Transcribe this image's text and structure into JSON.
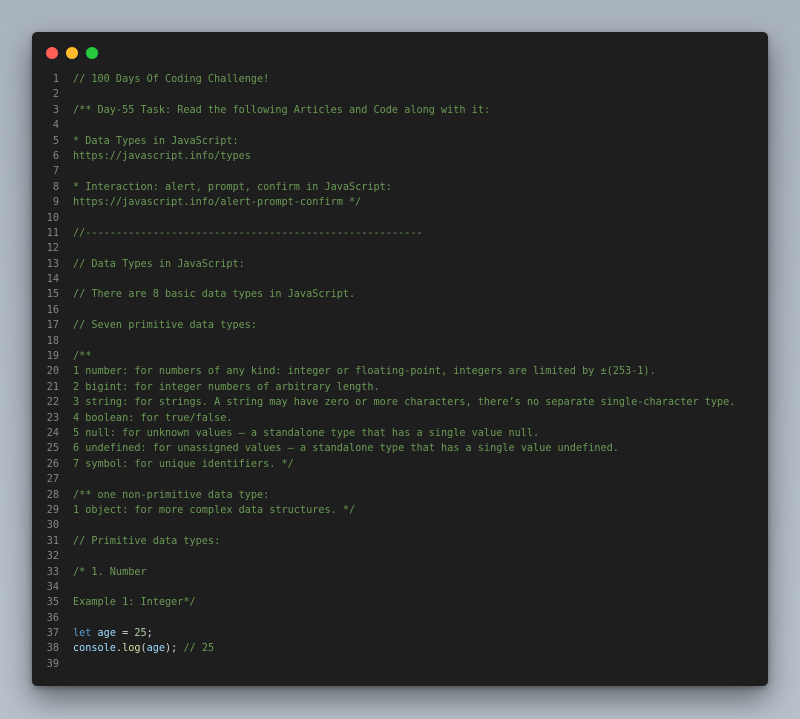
{
  "window": {
    "controls": [
      {
        "name": "close",
        "color": "#ff5f56"
      },
      {
        "name": "minimize",
        "color": "#ffbd2e"
      },
      {
        "name": "maximize",
        "color": "#27c93f"
      }
    ]
  },
  "lines": [
    {
      "n": "1",
      "tokens": [
        {
          "t": "comment",
          "v": "// 100 Days Of Coding Challenge!"
        }
      ]
    },
    {
      "n": "2",
      "tokens": []
    },
    {
      "n": "3",
      "tokens": [
        {
          "t": "comment",
          "v": "/** Day-55 Task: Read the following Articles and Code along with it:"
        }
      ]
    },
    {
      "n": "4",
      "tokens": []
    },
    {
      "n": "5",
      "tokens": [
        {
          "t": "comment",
          "v": "* Data Types in JavaScript:"
        }
      ]
    },
    {
      "n": "6",
      "tokens": [
        {
          "t": "comment",
          "v": "https://javascript.info/types"
        }
      ]
    },
    {
      "n": "7",
      "tokens": []
    },
    {
      "n": "8",
      "tokens": [
        {
          "t": "comment",
          "v": "* Interaction: alert, prompt, confirm in JavaScript:"
        }
      ]
    },
    {
      "n": "9",
      "tokens": [
        {
          "t": "comment",
          "v": "https://javascript.info/alert-prompt-confirm */"
        }
      ]
    },
    {
      "n": "10",
      "tokens": []
    },
    {
      "n": "11",
      "tokens": [
        {
          "t": "comment",
          "v": "//-------------------------------------------------------"
        }
      ]
    },
    {
      "n": "12",
      "tokens": []
    },
    {
      "n": "13",
      "tokens": [
        {
          "t": "comment",
          "v": "// Data Types in JavaScript:"
        }
      ]
    },
    {
      "n": "14",
      "tokens": []
    },
    {
      "n": "15",
      "tokens": [
        {
          "t": "comment",
          "v": "// There are 8 basic data types in JavaScript."
        }
      ]
    },
    {
      "n": "16",
      "tokens": []
    },
    {
      "n": "17",
      "tokens": [
        {
          "t": "comment",
          "v": "// Seven primitive data types:"
        }
      ]
    },
    {
      "n": "18",
      "tokens": []
    },
    {
      "n": "19",
      "tokens": [
        {
          "t": "comment",
          "v": "/**"
        }
      ]
    },
    {
      "n": "20",
      "tokens": [
        {
          "t": "comment",
          "v": "1 number: for numbers of any kind: integer or floating-point, integers are limited by ±(253-1)."
        }
      ]
    },
    {
      "n": "21",
      "tokens": [
        {
          "t": "comment",
          "v": "2 bigint: for integer numbers of arbitrary length."
        }
      ]
    },
    {
      "n": "22",
      "tokens": [
        {
          "t": "comment",
          "v": "3 string: for strings. A string may have zero or more characters, there’s no separate single-character type."
        }
      ]
    },
    {
      "n": "23",
      "tokens": [
        {
          "t": "comment",
          "v": "4 boolean: for true/false."
        }
      ]
    },
    {
      "n": "24",
      "tokens": [
        {
          "t": "comment",
          "v": "5 null: for unknown values – a standalone type that has a single value null."
        }
      ]
    },
    {
      "n": "25",
      "tokens": [
        {
          "t": "comment",
          "v": "6 undefined: for unassigned values – a standalone type that has a single value undefined."
        }
      ]
    },
    {
      "n": "26",
      "tokens": [
        {
          "t": "comment",
          "v": "7 symbol: for unique identifiers. */"
        }
      ]
    },
    {
      "n": "27",
      "tokens": []
    },
    {
      "n": "28",
      "tokens": [
        {
          "t": "comment",
          "v": "/** one non-primitive data type:"
        }
      ]
    },
    {
      "n": "29",
      "tokens": [
        {
          "t": "comment",
          "v": "1 object: for more complex data structures. */"
        }
      ]
    },
    {
      "n": "30",
      "tokens": []
    },
    {
      "n": "31",
      "tokens": [
        {
          "t": "comment",
          "v": "// Primitive data types:"
        }
      ]
    },
    {
      "n": "32",
      "tokens": []
    },
    {
      "n": "33",
      "tokens": [
        {
          "t": "comment",
          "v": "/* 1. Number"
        }
      ]
    },
    {
      "n": "34",
      "tokens": []
    },
    {
      "n": "35",
      "tokens": [
        {
          "t": "comment",
          "v": "Example 1: Integer*/"
        }
      ]
    },
    {
      "n": "36",
      "tokens": []
    },
    {
      "n": "37",
      "tokens": [
        {
          "t": "keyword",
          "v": "let"
        },
        {
          "t": "plain",
          "v": " "
        },
        {
          "t": "var",
          "v": "age"
        },
        {
          "t": "op",
          "v": " = "
        },
        {
          "t": "num",
          "v": "25"
        },
        {
          "t": "plain",
          "v": ";"
        }
      ]
    },
    {
      "n": "38",
      "tokens": [
        {
          "t": "var",
          "v": "console"
        },
        {
          "t": "plain",
          "v": "."
        },
        {
          "t": "fn",
          "v": "log"
        },
        {
          "t": "plain",
          "v": "("
        },
        {
          "t": "var",
          "v": "age"
        },
        {
          "t": "plain",
          "v": "); "
        },
        {
          "t": "comment",
          "v": "// 25"
        }
      ]
    },
    {
      "n": "39",
      "tokens": []
    }
  ]
}
